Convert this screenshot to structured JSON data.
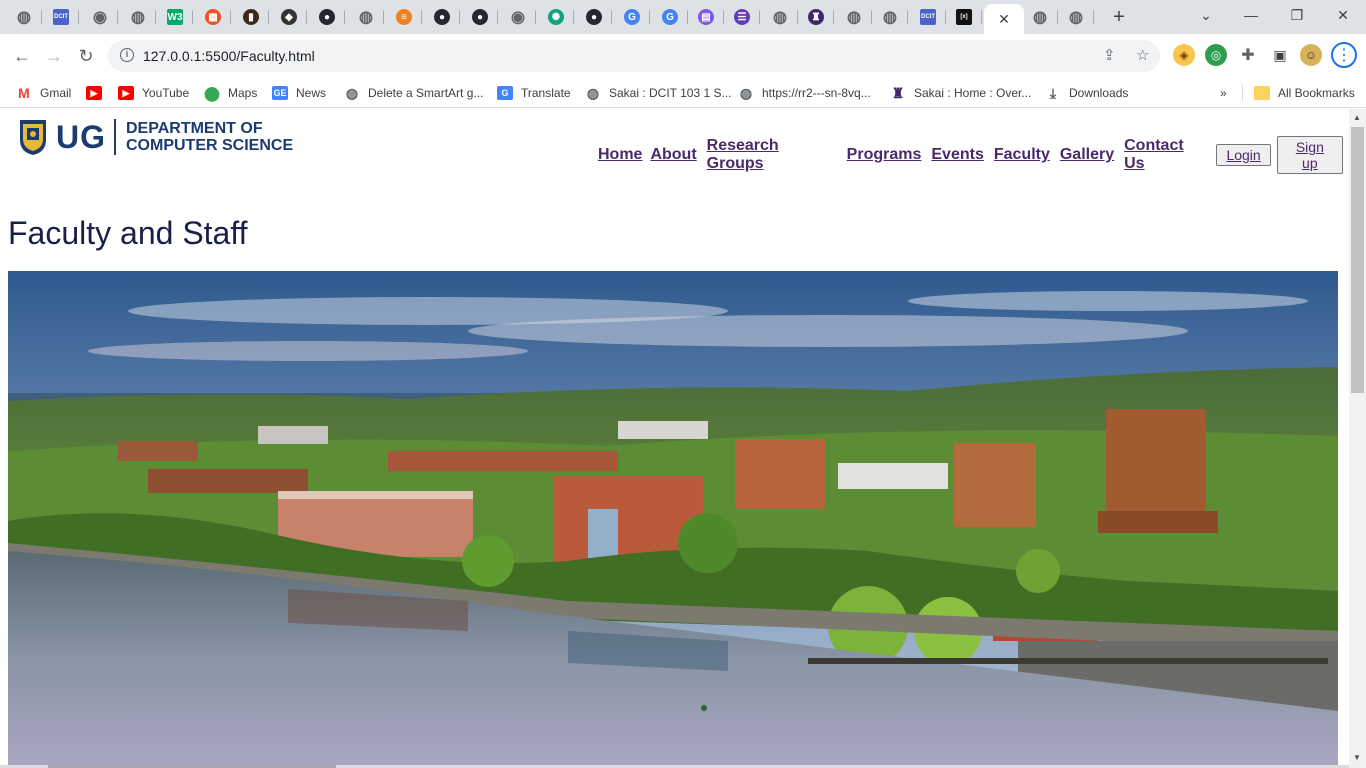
{
  "browser": {
    "url": "127.0.0.1:5500/Faculty.html",
    "tabs": [
      {
        "icon": "globe-icon",
        "color": "#5f6368",
        "glyph": "◍"
      },
      {
        "icon": "dcit-icon",
        "color": "#4a63c9",
        "glyph": "DCIT"
      },
      {
        "icon": "chrome-icon",
        "color": "#5f6368",
        "glyph": "◉"
      },
      {
        "icon": "globe-icon",
        "color": "#5f6368",
        "glyph": "◍"
      },
      {
        "icon": "w3schools-icon",
        "color": "#04aa6d",
        "glyph": "W3"
      },
      {
        "icon": "microsoft-icon",
        "color": "#f25022",
        "glyph": "▦"
      },
      {
        "icon": "book-icon",
        "color": "#3a2a1a",
        "glyph": "▮"
      },
      {
        "icon": "app-icon",
        "color": "#333333",
        "glyph": "◆"
      },
      {
        "icon": "github-icon",
        "color": "#24292f",
        "glyph": "●"
      },
      {
        "icon": "globe-icon",
        "color": "#5f6368",
        "glyph": "◍"
      },
      {
        "icon": "stackoverflow-icon",
        "color": "#f48024",
        "glyph": "≡"
      },
      {
        "icon": "github-icon",
        "color": "#24292f",
        "glyph": "●"
      },
      {
        "icon": "github-icon",
        "color": "#24292f",
        "glyph": "●"
      },
      {
        "icon": "chrome-icon",
        "color": "#5f6368",
        "glyph": "◉"
      },
      {
        "icon": "chatgpt-icon",
        "color": "#10a37f",
        "glyph": "✺"
      },
      {
        "icon": "github-icon",
        "color": "#24292f",
        "glyph": "●"
      },
      {
        "icon": "google-icon",
        "color": "#4285f4",
        "glyph": "G"
      },
      {
        "icon": "google-icon",
        "color": "#4285f4",
        "glyph": "G"
      },
      {
        "icon": "docs-icon",
        "color": "#7b5ce0",
        "glyph": "▤"
      },
      {
        "icon": "forms-icon",
        "color": "#673ab7",
        "glyph": "☰"
      },
      {
        "icon": "globe-icon",
        "color": "#5f6368",
        "glyph": "◍"
      },
      {
        "icon": "sakai-icon",
        "color": "#3b2a6b",
        "glyph": "♜"
      },
      {
        "icon": "globe-icon",
        "color": "#5f6368",
        "glyph": "◍"
      },
      {
        "icon": "globe-icon",
        "color": "#5f6368",
        "glyph": "◍"
      },
      {
        "icon": "dcit-icon",
        "color": "#4a63c9",
        "glyph": "DCIT"
      },
      {
        "icon": "codex-icon",
        "color": "#111111",
        "glyph": "[x]"
      },
      {
        "icon": "globe-icon",
        "color": "#5f6368",
        "glyph": "◍"
      },
      {
        "icon": "globe-icon",
        "color": "#5f6368",
        "glyph": "◍"
      }
    ],
    "bookmarks": [
      {
        "label": "Gmail",
        "icon": "gmail-icon",
        "color": "#ea4335",
        "glyph": "M"
      },
      {
        "label": "",
        "icon": "youtube-icon",
        "color": "#ff0000",
        "glyph": "▶"
      },
      {
        "label": "YouTube",
        "icon": "youtube-icon",
        "color": "#ff0000",
        "glyph": "▶"
      },
      {
        "label": "Maps",
        "icon": "maps-icon",
        "color": "#34a853",
        "glyph": "⬤"
      },
      {
        "label": "News",
        "icon": "news-icon",
        "color": "#4285f4",
        "glyph": "GE"
      },
      {
        "label": "Delete a SmartArt g...",
        "icon": "globe-icon",
        "color": "#5f6368",
        "glyph": "◍"
      },
      {
        "label": "Translate",
        "icon": "translate-icon",
        "color": "#4285f4",
        "glyph": "G"
      },
      {
        "label": "Sakai : DCIT 103 1 S...",
        "icon": "globe-icon",
        "color": "#5f6368",
        "glyph": "◍"
      },
      {
        "label": "https://rr2---sn-8vq...",
        "icon": "globe-icon",
        "color": "#5f6368",
        "glyph": "◍"
      },
      {
        "label": "Sakai : Home : Over...",
        "icon": "sakai-icon",
        "color": "#3b2a6b",
        "glyph": "♜"
      },
      {
        "label": "Downloads",
        "icon": "download-icon",
        "color": "#5f6368",
        "glyph": "⤓"
      }
    ],
    "all_bookmarks": "All Bookmarks"
  },
  "site": {
    "logo_short": "UG",
    "logo_line1": "DEPARTMENT OF",
    "logo_line2": "COMPUTER SCIENCE",
    "nav": [
      "Home",
      "About",
      "Research Groups",
      "Programs",
      "Events",
      "Faculty",
      "Gallery",
      "Contact Us"
    ],
    "login": "Login",
    "signup": "Sign up",
    "page_title": "Faculty and Staff"
  }
}
